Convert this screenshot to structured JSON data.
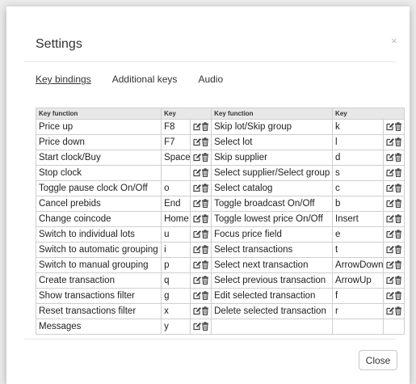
{
  "dialog": {
    "title": "Settings",
    "close_glyph": "×",
    "close_button_label": "Close"
  },
  "tabs": [
    {
      "label": "Key bindings",
      "active": true
    },
    {
      "label": "Additional keys",
      "active": false
    },
    {
      "label": "Audio",
      "active": false
    }
  ],
  "table": {
    "headers": [
      "Key function",
      "Key",
      "Key function",
      "Key"
    ],
    "row_icons": [
      "edit-icon",
      "delete-icon"
    ],
    "rows": [
      {
        "left": {
          "function": "Price up",
          "key": "F8"
        },
        "right": {
          "function": "Skip lot/Skip group",
          "key": "k"
        }
      },
      {
        "left": {
          "function": "Price down",
          "key": "F7"
        },
        "right": {
          "function": "Select lot",
          "key": "l"
        }
      },
      {
        "left": {
          "function": "Start clock/Buy",
          "key": "Space"
        },
        "right": {
          "function": "Skip supplier",
          "key": "d"
        }
      },
      {
        "left": {
          "function": "Stop clock",
          "key": ""
        },
        "right": {
          "function": "Select supplier/Select group",
          "key": "s"
        }
      },
      {
        "left": {
          "function": "Toggle pause clock On/Off",
          "key": "o"
        },
        "right": {
          "function": "Select catalog",
          "key": "c"
        }
      },
      {
        "left": {
          "function": "Cancel prebids",
          "key": "End"
        },
        "right": {
          "function": "Toggle broadcast On/Off",
          "key": "b"
        }
      },
      {
        "left": {
          "function": "Change coincode",
          "key": "Home"
        },
        "right": {
          "function": "Toggle lowest price On/Off",
          "key": "Insert"
        }
      },
      {
        "left": {
          "function": "Switch to individual lots",
          "key": "u"
        },
        "right": {
          "function": "Focus price field",
          "key": "e"
        }
      },
      {
        "left": {
          "function": "Switch to automatic grouping",
          "key": "i"
        },
        "right": {
          "function": "Select transactions",
          "key": "t"
        }
      },
      {
        "left": {
          "function": "Switch to manual grouping",
          "key": "p"
        },
        "right": {
          "function": "Select next transaction",
          "key": "ArrowDown"
        }
      },
      {
        "left": {
          "function": "Create transaction",
          "key": "q"
        },
        "right": {
          "function": "Select previous transaction",
          "key": "ArrowUp"
        }
      },
      {
        "left": {
          "function": "Show transactions filter",
          "key": "g"
        },
        "right": {
          "function": "Edit selected transaction",
          "key": "f"
        }
      },
      {
        "left": {
          "function": "Reset transactions filter",
          "key": "x"
        },
        "right": {
          "function": "Delete selected transaction",
          "key": "r"
        }
      },
      {
        "left": {
          "function": "Messages",
          "key": "y"
        },
        "right": null
      }
    ]
  }
}
